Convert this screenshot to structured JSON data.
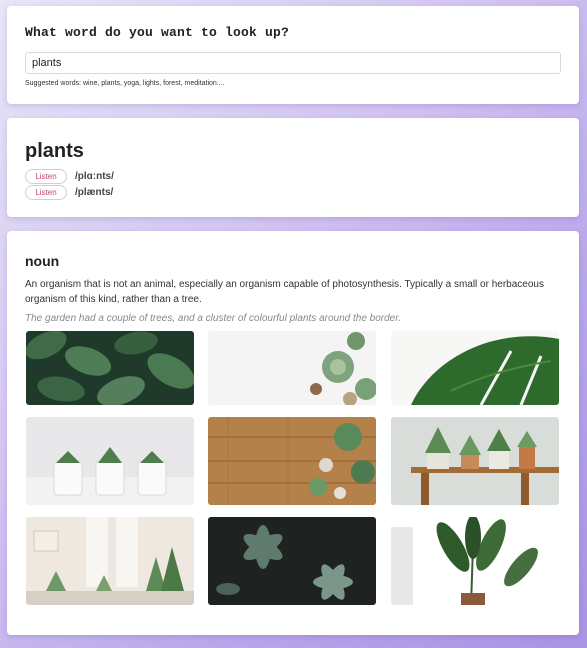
{
  "search": {
    "title": "What word do you want to look up?",
    "value": "plants",
    "suggestions": "Suggested words: wine, plants, yoga, lights, forest, meditation...."
  },
  "word": {
    "headword": "plants",
    "pronunciations": [
      {
        "listen_label": "Listen",
        "phonetic": "/plɑːnts/"
      },
      {
        "listen_label": "Listen",
        "phonetic": "/plænts/"
      }
    ]
  },
  "definition": {
    "part_of_speech": "noun",
    "text": "An organism that is not an animal, especially an organism capable of photosynthesis. Typically a small or herbaceous organism of this kind, rather than a tree.",
    "example": "The garden had a couple of trees, and a cluster of colourful plants around the border."
  },
  "gallery": {
    "images": [
      "dark-leaves-photo",
      "succulents-on-white-photo",
      "monstera-leaf-photo",
      "potted-succulents-photo",
      "wood-table-succulents-photo",
      "shelf-plants-photo",
      "window-plants-photo",
      "dark-succulent-photo",
      "tall-plant-photo"
    ]
  }
}
